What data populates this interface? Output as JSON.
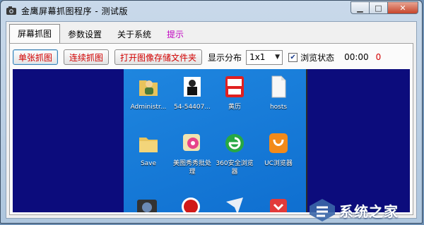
{
  "window": {
    "title": "金鹰屏幕抓图程序 - 测试版"
  },
  "tabs": [
    {
      "label": "屏幕抓图"
    },
    {
      "label": "参数设置"
    },
    {
      "label": "关于系统"
    },
    {
      "label": "提示"
    }
  ],
  "toolbar": {
    "single_capture": "单张抓图",
    "continuous_capture": "连续抓图",
    "open_folder": "打开图像存储文件夹",
    "display_layout_label": "显示分布",
    "display_layout_value": "1x1",
    "browse_state_label": "浏览状态",
    "browse_state_checked": true,
    "timer": "00:00",
    "count": "0"
  },
  "desktop_icons": [
    {
      "label": "Administr...",
      "icon": "user-folder-icon"
    },
    {
      "label": "54-54407...",
      "icon": "photo-shortcut-icon"
    },
    {
      "label": "黄历",
      "icon": "calendar-app-icon"
    },
    {
      "label": "hosts",
      "icon": "file-icon"
    },
    {
      "label": "Save",
      "icon": "folder-icon"
    },
    {
      "label": "美图秀秀批处理",
      "icon": "meitu-batch-icon"
    },
    {
      "label": "360安全浏览器",
      "icon": "browser-360-icon"
    },
    {
      "label": "UC浏览器",
      "icon": "uc-browser-icon"
    }
  ],
  "watermark": {
    "text": "系统之家"
  },
  "colors": {
    "accent_red": "#d20000",
    "viewer_bg": "#0c0c7c",
    "desktop_bg": "#1f86df"
  }
}
